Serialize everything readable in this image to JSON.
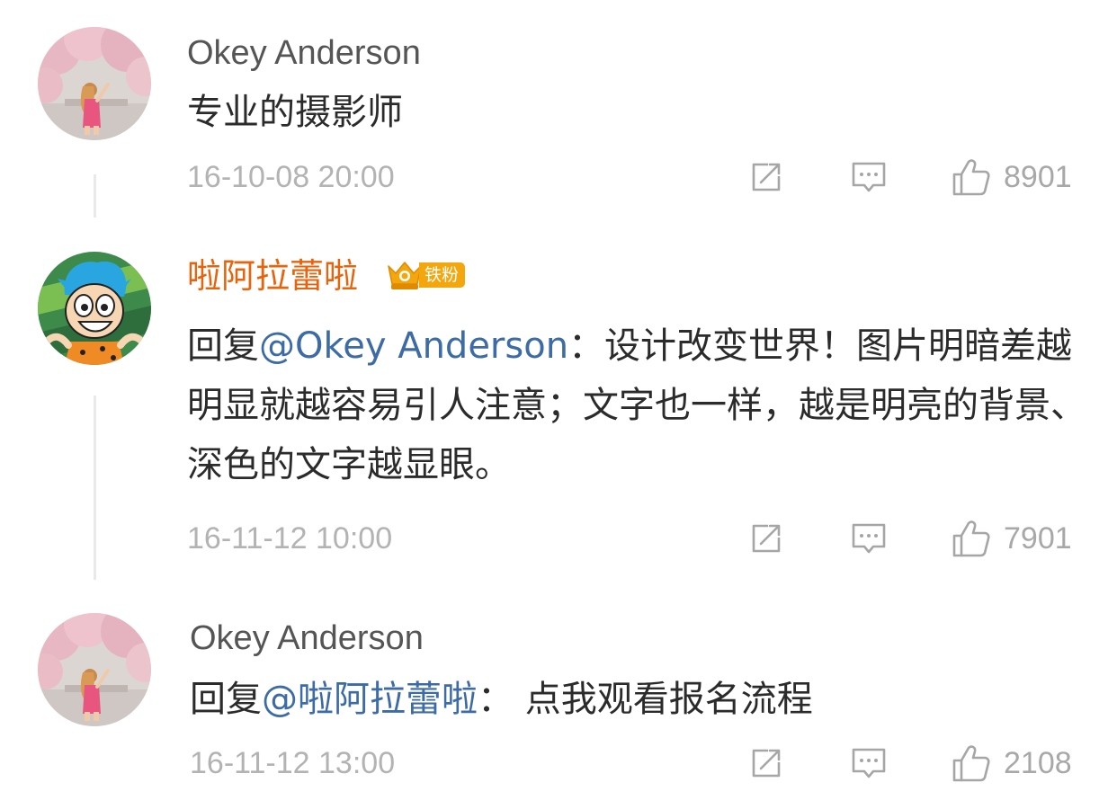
{
  "comments": [
    {
      "author": "Okey Anderson",
      "text": "专业的摄影师",
      "time": "16-10-08 20:00",
      "likes": "8901",
      "avatar_icon": "girl-blossom-photo"
    },
    {
      "author": "啦阿拉蕾啦",
      "badge": "铁粉",
      "reply_prefix": "回复",
      "mention": "@Okey Anderson",
      "text": "：设计改变世界！图片明暗差越明显就越容易引人注意；文字也一样，越是明亮的背景、深色的文字越显眼。",
      "time": "16-11-12 10:00",
      "likes": "7901",
      "avatar_icon": "cartoon-blue-hair"
    },
    {
      "author": "Okey Anderson",
      "reply_prefix": "回复",
      "mention": "@啦阿拉蕾啦",
      "text": "：  点我观看报名流程",
      "time": "16-11-12 13:00",
      "likes": "2108",
      "avatar_icon": "girl-blossom-photo"
    }
  ],
  "icons": {
    "share": "share-icon",
    "comment": "comment-icon",
    "like": "thumbs-up-icon"
  },
  "colors": {
    "author_vip": "#e8630b",
    "mention": "#3d6ba6",
    "badge": "#f4a60d"
  }
}
